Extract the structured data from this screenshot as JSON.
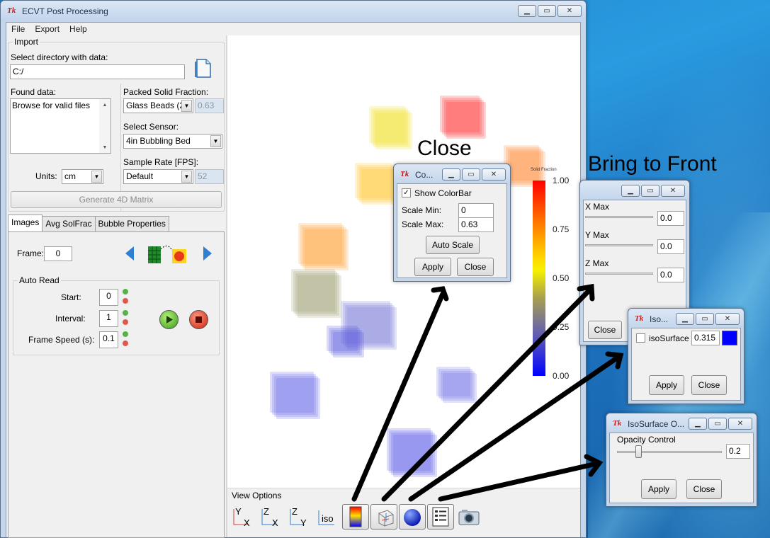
{
  "main_window": {
    "title": "ECVT Post Processing",
    "menu": [
      "File",
      "Export",
      "Help"
    ],
    "import": {
      "group_label": "Import",
      "dir_label": "Select directory with data:",
      "dir_value": "C:/",
      "found_label": "Found data:",
      "found_items": [
        "Browse for valid files"
      ],
      "units_label": "Units:",
      "units_value": "cm",
      "packed_label": "Packed Solid Fraction:",
      "packed_value": "Glass Beads (2",
      "packed_readonly": "0.63",
      "sensor_label": "Select Sensor:",
      "sensor_value": "4in Bubbling Bed",
      "rate_label": "Sample Rate [FPS]:",
      "rate_value": "Default",
      "rate_readonly": "52",
      "generate_label": "Generate 4D Matrix"
    },
    "tabs": [
      "Images",
      "Avg SolFrac",
      "Bubble Properties"
    ],
    "active_tab": "Images",
    "images_tab": {
      "frame_label": "Frame:",
      "frame_value": "0",
      "auto_read_label": "Auto Read",
      "start_label": "Start:",
      "start_value": "0",
      "interval_label": "Interval:",
      "interval_value": "1",
      "speed_label": "Frame Speed (s):",
      "speed_value": "0.1"
    },
    "colorbar": {
      "title": "Solid Fraction",
      "ticks": [
        "1.00",
        "0.75",
        "0.50",
        "0.25",
        "0.00"
      ]
    },
    "view_options": {
      "label": "View Options",
      "buttons": [
        {
          "name": "view-yx",
          "a": "Y",
          "b": "X"
        },
        {
          "name": "view-zx",
          "a": "Z",
          "b": "X"
        },
        {
          "name": "view-zy",
          "a": "Z",
          "b": "Y"
        },
        {
          "name": "iso",
          "a": "iso",
          "b": ""
        }
      ]
    }
  },
  "colorbar_dialog": {
    "title": "Co...",
    "show_label": "Show ColorBar",
    "show_checked": true,
    "min_label": "Scale Min:",
    "min_value": "0",
    "max_label": "Scale Max:",
    "max_value": "0.63",
    "auto_label": "Auto Scale",
    "apply_label": "Apply",
    "close_label": "Close"
  },
  "slice_dialog": {
    "labels": [
      "X Max",
      "Y Max",
      "Z Max"
    ],
    "values": [
      "0.0",
      "0.0",
      "0.0"
    ],
    "close_label": "Close"
  },
  "iso_dialog": {
    "title": "Iso...",
    "check_label": "isoSurface",
    "checked": false,
    "value": "0.315",
    "color": "#0000ff",
    "apply_label": "Apply",
    "close_label": "Close"
  },
  "opacity_dialog": {
    "title": "IsoSurface O...",
    "label": "Opacity Control",
    "value": "0.2",
    "slider_fraction": 0.2,
    "apply_label": "Apply",
    "close_label": "Close"
  },
  "annotations": {
    "close": "Close",
    "bring_front": "Bring to Front"
  },
  "colors": {
    "accent_blue": "#0000ff",
    "arrow": "#000000",
    "tk_red": "#c21c1c"
  }
}
